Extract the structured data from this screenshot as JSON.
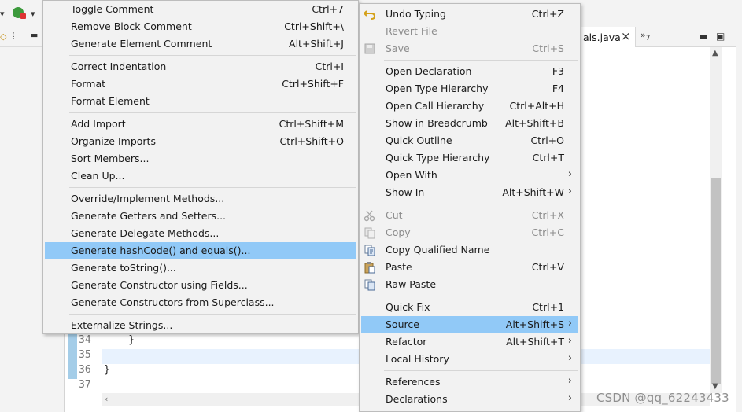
{
  "editor": {
    "tab_label": "als.java",
    "tab_close": "×",
    "tab_more": "»",
    "tab_more_count": "7",
    "line_numbers": [
      "34",
      "35",
      "36",
      "37"
    ],
    "code_lines": [
      "    }",
      "",
      "}",
      ""
    ]
  },
  "watermark": "CSDN @qq_62243433",
  "left_menu": {
    "items": [
      {
        "label": "Toggle Comment",
        "shortcut": "Ctrl+7"
      },
      {
        "label": "Remove Block Comment",
        "shortcut": "Ctrl+Shift+\\"
      },
      {
        "label": "Generate Element Comment",
        "shortcut": "Alt+Shift+J"
      },
      {
        "label": "Correct Indentation",
        "shortcut": "Ctrl+I"
      },
      {
        "label": "Format",
        "shortcut": "Ctrl+Shift+F"
      },
      {
        "label": "Format Element",
        "shortcut": ""
      },
      {
        "label": "Add Import",
        "shortcut": "Ctrl+Shift+M"
      },
      {
        "label": "Organize Imports",
        "shortcut": "Ctrl+Shift+O"
      },
      {
        "label": "Sort Members...",
        "shortcut": ""
      },
      {
        "label": "Clean Up...",
        "shortcut": ""
      },
      {
        "label": "Override/Implement Methods...",
        "shortcut": ""
      },
      {
        "label": "Generate Getters and Setters...",
        "shortcut": ""
      },
      {
        "label": "Generate Delegate Methods...",
        "shortcut": ""
      },
      {
        "label": "Generate hashCode() and equals()...",
        "shortcut": ""
      },
      {
        "label": "Generate toString()...",
        "shortcut": ""
      },
      {
        "label": "Generate Constructor using Fields...",
        "shortcut": ""
      },
      {
        "label": "Generate Constructors from Superclass...",
        "shortcut": ""
      },
      {
        "label": "Externalize Strings...",
        "shortcut": ""
      }
    ]
  },
  "right_menu": {
    "items": [
      {
        "label": "Undo Typing",
        "shortcut": "Ctrl+Z"
      },
      {
        "label": "Revert File",
        "shortcut": ""
      },
      {
        "label": "Save",
        "shortcut": "Ctrl+S"
      },
      {
        "label": "Open Declaration",
        "shortcut": "F3"
      },
      {
        "label": "Open Type Hierarchy",
        "shortcut": "F4"
      },
      {
        "label": "Open Call Hierarchy",
        "shortcut": "Ctrl+Alt+H"
      },
      {
        "label": "Show in Breadcrumb",
        "shortcut": "Alt+Shift+B"
      },
      {
        "label": "Quick Outline",
        "shortcut": "Ctrl+O"
      },
      {
        "label": "Quick Type Hierarchy",
        "shortcut": "Ctrl+T"
      },
      {
        "label": "Open With",
        "shortcut": ""
      },
      {
        "label": "Show In",
        "shortcut": "Alt+Shift+W"
      },
      {
        "label": "Cut",
        "shortcut": "Ctrl+X"
      },
      {
        "label": "Copy",
        "shortcut": "Ctrl+C"
      },
      {
        "label": "Copy Qualified Name",
        "shortcut": ""
      },
      {
        "label": "Paste",
        "shortcut": "Ctrl+V"
      },
      {
        "label": "Raw Paste",
        "shortcut": ""
      },
      {
        "label": "Quick Fix",
        "shortcut": "Ctrl+1"
      },
      {
        "label": "Source",
        "shortcut": "Alt+Shift+S"
      },
      {
        "label": "Refactor",
        "shortcut": "Alt+Shift+T"
      },
      {
        "label": "Local History",
        "shortcut": ""
      },
      {
        "label": "References",
        "shortcut": ""
      },
      {
        "label": "Declarations",
        "shortcut": ""
      }
    ],
    "submenu_arrow": "›"
  },
  "colors": {
    "selection": "#91c9f7",
    "menu_bg": "#f2f2f2",
    "disabled_text": "#8d8d8d"
  },
  "icons": [
    "undo-icon",
    "save-icon",
    "cut-icon",
    "copy-icon",
    "copy-qualified-name-icon",
    "paste-icon",
    "raw-paste-icon",
    "run-icon",
    "dropdown-arrow-icon",
    "minimize-icon",
    "maximize-icon"
  ]
}
